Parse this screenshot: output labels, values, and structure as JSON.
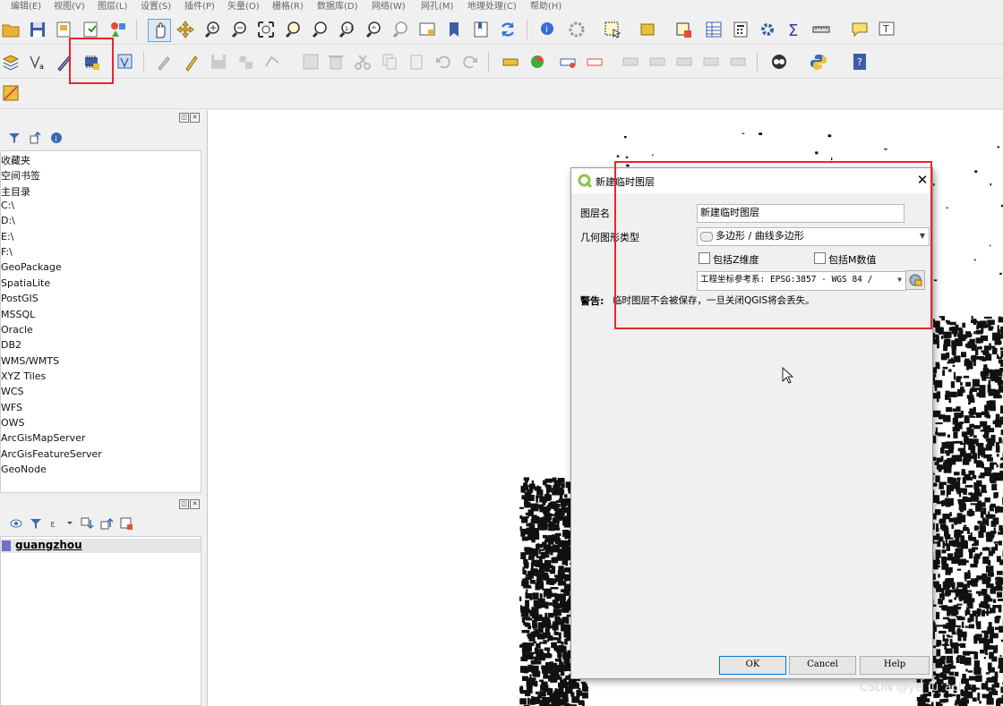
{
  "menu": [
    "编辑(E)",
    "视图(V)",
    "图层(L)",
    "设置(S)",
    "插件(P)",
    "矢量(O)",
    "栅格(R)",
    "数据库(D)",
    "网络(W)",
    "网孔(M)",
    "地理处理(C)",
    "帮助(H)"
  ],
  "browser_panel": {
    "items": [
      "收藏夹",
      "空间书签",
      "主目录",
      "C:\\",
      "D:\\",
      "E:\\",
      "F:\\",
      "GeoPackage",
      "SpatiaLite",
      "PostGIS",
      "MSSQL",
      "Oracle",
      "DB2",
      "WMS/WMTS",
      "XYZ Tiles",
      "WCS",
      "WFS",
      "OWS",
      "ArcGisMapServer",
      "ArcGisFeatureServer",
      "GeoNode"
    ]
  },
  "layers_panel": {
    "layers": [
      {
        "name": "guangzhou",
        "color": "#6f6fd0"
      }
    ]
  },
  "dialog": {
    "title": "新建临时图层",
    "layer_name_label": "图层名",
    "layer_name_value": "新建临时图层",
    "geometry_type_label": "几何图形类型",
    "geometry_type_value": "多边形 / 曲线多边形",
    "include_z_label": "包括Z维度",
    "include_m_label": "包括M数值",
    "include_z_checked": false,
    "include_m_checked": false,
    "crs_value": "工程坐标参考系: EPSG:3857 - WGS 84 /",
    "warning_label": "警告:",
    "warning_text": "临时图层不会被保存，一旦关闭QGIS将会丢失。",
    "ok_label": "OK",
    "cancel_label": "Cancel",
    "help_label": "Help"
  },
  "watermark": "CSDN @ye_lu_ach",
  "colors": {
    "accent_red": "#e8262a",
    "qgis_green": "#8bc34a",
    "map_features": "#111111"
  }
}
